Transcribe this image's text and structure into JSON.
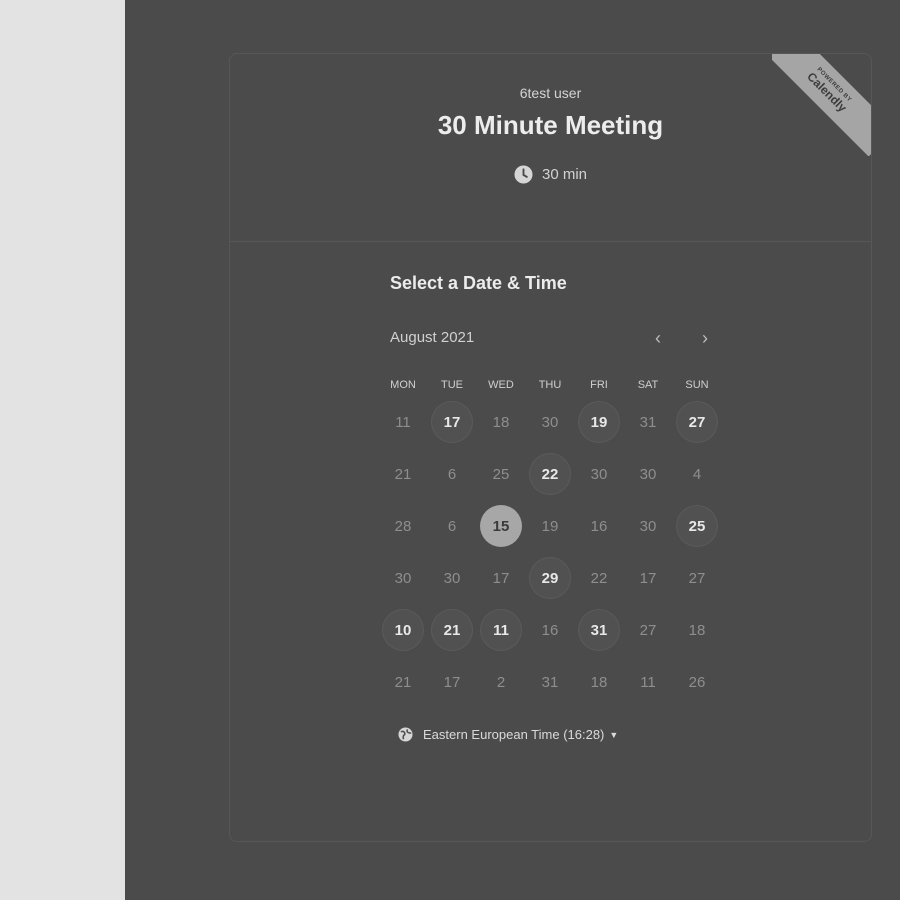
{
  "event": {
    "owner": "6test user",
    "title": "30 Minute Meeting",
    "duration": "30 min",
    "clock_icon": "clock-icon"
  },
  "badge": {
    "small": "POWERED BY",
    "brand": "Calendly"
  },
  "calendar": {
    "section_title": "Select a Date & Time",
    "month": "August 2021",
    "prev_icon": "chevron-left-icon",
    "next_icon": "chevron-right-icon",
    "weekdays": [
      "MON",
      "TUE",
      "WED",
      "THU",
      "FRI",
      "SAT",
      "SUN"
    ],
    "weeks": [
      [
        {
          "d": "11",
          "a": false
        },
        {
          "d": "17",
          "a": true
        },
        {
          "d": "18",
          "a": false
        },
        {
          "d": "30",
          "a": false
        },
        {
          "d": "19",
          "a": true
        },
        {
          "d": "31",
          "a": false
        },
        {
          "d": "27",
          "a": true
        }
      ],
      [
        {
          "d": "21",
          "a": false
        },
        {
          "d": "6",
          "a": false
        },
        {
          "d": "25",
          "a": false
        },
        {
          "d": "22",
          "a": true
        },
        {
          "d": "30",
          "a": false
        },
        {
          "d": "30",
          "a": false
        },
        {
          "d": "4",
          "a": false
        }
      ],
      [
        {
          "d": "28",
          "a": false
        },
        {
          "d": "6",
          "a": false
        },
        {
          "d": "15",
          "a": true,
          "selected": true
        },
        {
          "d": "19",
          "a": false
        },
        {
          "d": "16",
          "a": false
        },
        {
          "d": "30",
          "a": false
        },
        {
          "d": "25",
          "a": true
        }
      ],
      [
        {
          "d": "30",
          "a": false
        },
        {
          "d": "30",
          "a": false
        },
        {
          "d": "17",
          "a": false
        },
        {
          "d": "29",
          "a": true
        },
        {
          "d": "22",
          "a": false
        },
        {
          "d": "17",
          "a": false
        },
        {
          "d": "27",
          "a": false
        }
      ],
      [
        {
          "d": "10",
          "a": true
        },
        {
          "d": "21",
          "a": true
        },
        {
          "d": "11",
          "a": true
        },
        {
          "d": "16",
          "a": false
        },
        {
          "d": "31",
          "a": true
        },
        {
          "d": "27",
          "a": false
        },
        {
          "d": "18",
          "a": false
        }
      ],
      [
        {
          "d": "21",
          "a": false
        },
        {
          "d": "17",
          "a": false
        },
        {
          "d": "2",
          "a": false
        },
        {
          "d": "31",
          "a": false
        },
        {
          "d": "18",
          "a": false
        },
        {
          "d": "11",
          "a": false
        },
        {
          "d": "26",
          "a": false
        }
      ]
    ]
  },
  "timezone": {
    "label": "Eastern European Time (16:28)",
    "icon": "globe-icon"
  },
  "colors": {
    "overlay": "#4b4b4b",
    "left_panel": "#e3e3e3",
    "selected_day": "#a7a7a7"
  }
}
